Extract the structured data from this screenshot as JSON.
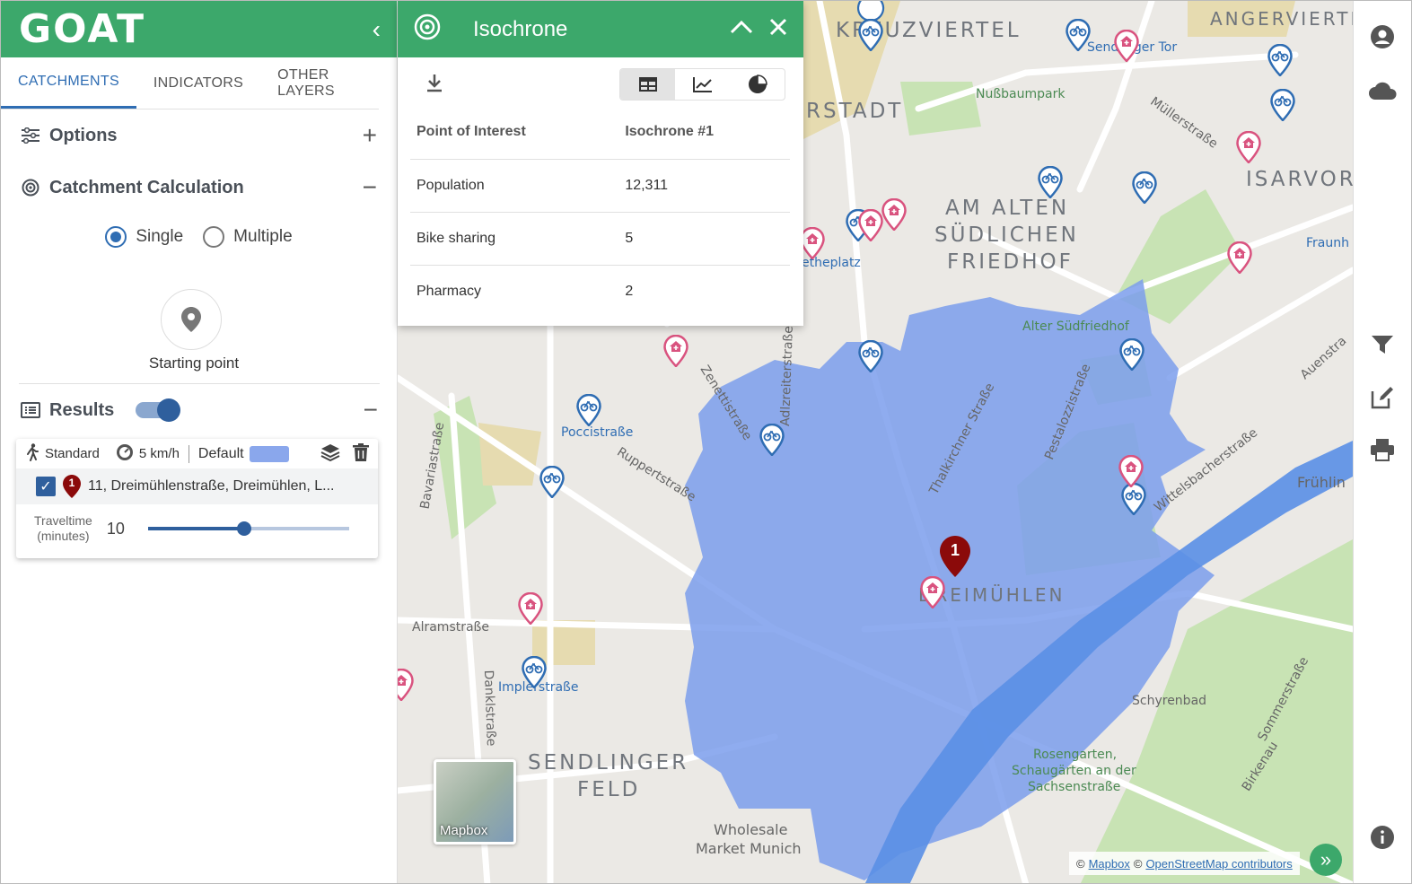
{
  "app": {
    "logo": "GOAT"
  },
  "tabs": [
    {
      "label": "CATCHMENTS"
    },
    {
      "label": "INDICATORS"
    },
    {
      "label": "OTHER LAYERS"
    }
  ],
  "options": {
    "title": "Options"
  },
  "catchment": {
    "title": "Catchment Calculation",
    "mode_single": "Single",
    "mode_multiple": "Multiple",
    "starting_point": "Starting point"
  },
  "results": {
    "title": "Results",
    "card": {
      "mode": "Standard",
      "speed": "5 km/h",
      "style": "Default",
      "color": "#8aa7ec",
      "marker_number": "1",
      "address": "11, Dreimühlenstraße, Dreimühlen, L...",
      "traveltime_label_1": "Traveltime",
      "traveltime_label_2": "(minutes)",
      "traveltime_value": "10",
      "slider_fraction": 0.48
    }
  },
  "popup": {
    "title": "Isochrone",
    "table": {
      "headers": [
        "Point of Interest",
        "Isochrone #1"
      ],
      "rows": [
        [
          "Population",
          "12,311"
        ],
        [
          "Bike sharing",
          "5"
        ],
        [
          "Pharmacy",
          "2"
        ]
      ]
    }
  },
  "map": {
    "labels": {
      "kreuzviertel": "KREUZVIERTEL",
      "angerviertel": "ANGERVIERTEL",
      "stadt": "RSTADT",
      "isarvor": "ISARVOR",
      "am_alten_1": "AM ALTEN",
      "am_alten_2": "SÜDLICHEN",
      "am_alten_3": "FRIEDHOF",
      "dreimuehlen": "DREIMÜHLEN",
      "sendlinger_1": "SENDLINGER",
      "sendlinger_2": "FELD",
      "nussbaumpark": "Nußbaumpark",
      "alter_suedfriedhof": "Alter Südfriedhof",
      "schyrenbad": "Schyrenbad",
      "rosengarten_1": "Rosengarten,",
      "rosengarten_2": "Schaugärten an der",
      "rosengarten_3": "Sachsenstraße",
      "wholesale_1": "Wholesale",
      "wholesale_2": "Market Munich",
      "poccistrasse": "Poccistraße",
      "implerstrasse": "Implerstraße",
      "alramstrasse": "Alramstraße",
      "ruppertstrasse": "Ruppertstraße",
      "thalkirchner": "Thalkirchner Straße",
      "wittelsbacher": "Wittelsbacherstraße",
      "muellerstrasse": "Müllerstraße",
      "senator": "Sendlinger Tor",
      "goetheplatz": "etheplatz",
      "fraunh": "Fraunh",
      "fruehlin": "Frühlin",
      "auenstr": "Auenstra",
      "bavariastr": "Bavariastraße",
      "pestalozzi": "Pestalozzistraße",
      "zenetti": "Zenettistraße",
      "kapuziner": "Adlzreiterstraße",
      "danklstr": "Danklstraße",
      "sommerstr": "Sommerstraße",
      "birkenau": "Birkenau"
    },
    "mapbox_thumb": "Mapbox",
    "attribution_mapbox": "Mapbox",
    "attribution_osm": "OpenStreetMap contributors",
    "isochrone_color": "#7b9dec"
  }
}
